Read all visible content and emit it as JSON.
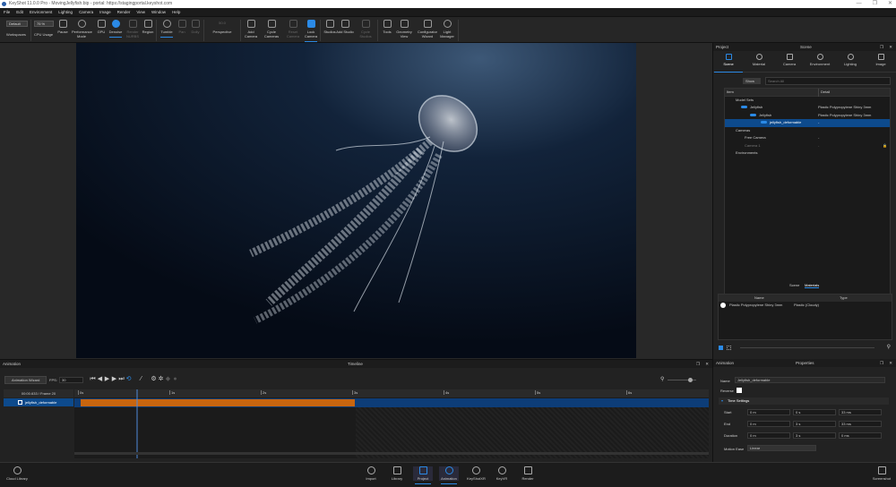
{
  "window": {
    "title": "KeyShot 11.0.0 Pro - MovingJellyfish.bip - portal: https://stagingportal.keyshot.com",
    "minimize": "—",
    "restore": "❐",
    "close": "✕"
  },
  "menu": [
    "File",
    "Edit",
    "Environment",
    "Lighting",
    "Camera",
    "Image",
    "Render",
    "View",
    "Window",
    "Help"
  ],
  "toolbar": {
    "workspace_value": "Default",
    "workspace_label": "Workspaces",
    "cpu_value": "75 %",
    "cpu_label": "CPU Usage",
    "buttons": [
      {
        "label": "Pause"
      },
      {
        "label": "Performance Mode"
      },
      {
        "label": "GPU"
      },
      {
        "label": "Denoise"
      },
      {
        "label": "Render NURBS"
      },
      {
        "label": "Region"
      },
      {
        "label": "Tumble"
      },
      {
        "label": "Pan"
      },
      {
        "label": "Dolly"
      },
      {
        "label": "Perspective"
      },
      {
        "label": "Add Camera"
      },
      {
        "label": "Cycle Cameras"
      },
      {
        "label": "Reset Camera"
      },
      {
        "label": "Lock Camera"
      },
      {
        "label": "Studios"
      },
      {
        "label": "Add Studio"
      },
      {
        "label": "Cycle Studios"
      },
      {
        "label": "Tools"
      },
      {
        "label": "Geometry View"
      },
      {
        "label": "Configurator Wizard"
      },
      {
        "label": "Light Manager"
      }
    ],
    "perspective_value": "50.0"
  },
  "accent": "#2b8ae6",
  "keyframe_color": "#c8650f",
  "project": {
    "panel_title": "Project",
    "section_title": "Scene",
    "tabs": [
      "Scene",
      "Material",
      "Camera",
      "Environment",
      "Lighting",
      "Image"
    ],
    "show_label": "Show",
    "search_placeholder": "Search All",
    "col_item": "Item",
    "col_detail": "Detail",
    "tree": [
      {
        "name": "Model Sets",
        "detail": ""
      },
      {
        "name": "Jellyfish",
        "detail": "Plastic Polypropylene Shiny 3mm"
      },
      {
        "name": "Jellyfish",
        "detail": "Plastic Polypropylene Shiny 3mm"
      },
      {
        "name": "jellyfish_deformable",
        "detail": "-"
      },
      {
        "name": "Cameras",
        "detail": ""
      },
      {
        "name": "Free Camera",
        "detail": "-"
      },
      {
        "name": "Camera 1",
        "detail": "-"
      },
      {
        "name": "Environments",
        "detail": ""
      }
    ],
    "subtabs": [
      "Scene",
      "Materials"
    ],
    "mat_col_name": "Name",
    "mat_col_type": "Type",
    "materials": [
      {
        "name": "Plastic Polypropylene Shiny 3mm",
        "type": "Plastic (Cloudy)"
      }
    ]
  },
  "animation": {
    "panel_title": "Animation",
    "section_title": "Timeline",
    "wizard_label": "Animation Wizard",
    "fps_label": "FPS:",
    "fps_value": "30",
    "time_readout": "00:00.633 / Frame 20",
    "ticks": [
      "0s",
      "1s",
      "2s",
      "3s",
      "4s",
      "5s",
      "6s"
    ],
    "track": "jellyfish_deformable",
    "playhead_seconds": 0.633,
    "clip_start_s": 0.033,
    "clip_end_s": 3.033
  },
  "properties": {
    "panel_title": "Animation",
    "section_title": "Properties",
    "name_label": "Name",
    "name_value": "Jellyfish_deformable",
    "reverse_label": "Reverse",
    "time_settings": "Time Settings",
    "rows": [
      {
        "label": "Start",
        "values": [
          "0 m",
          "0 s",
          "33 ms"
        ]
      },
      {
        "label": "End",
        "values": [
          "0 m",
          "3 s",
          "33 ms"
        ]
      },
      {
        "label": "Duration",
        "values": [
          "0 m",
          "3 s",
          "0 ms"
        ]
      }
    ],
    "motion_ease_label": "Motion Ease",
    "motion_ease_value": "Linear"
  },
  "bottombar": {
    "cloud": "Cloud Library",
    "items": [
      "Import",
      "Library",
      "Project",
      "Animation",
      "KeyShotXR",
      "KeyVR",
      "Render"
    ],
    "screenshot": "Screenshot"
  }
}
